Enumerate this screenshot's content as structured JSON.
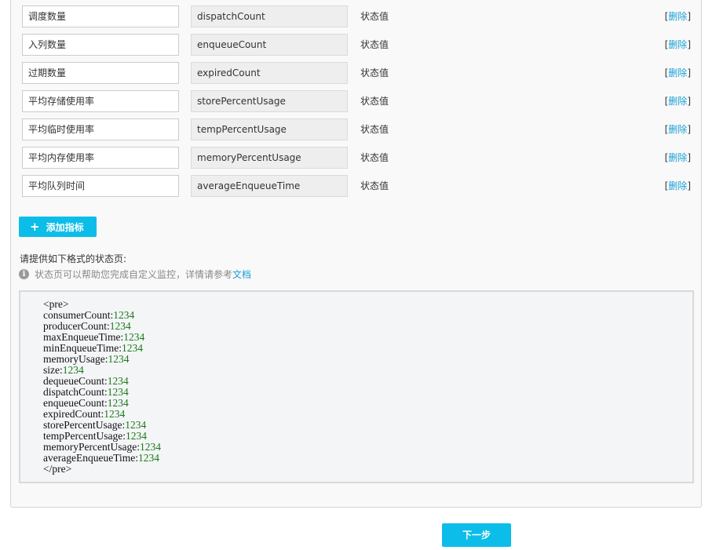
{
  "metrics": [
    {
      "name": "调度数量",
      "key": "dispatchCount",
      "type": "状态值",
      "delete": "删除"
    },
    {
      "name": "入列数量",
      "key": "enqueueCount",
      "type": "状态值",
      "delete": "删除"
    },
    {
      "name": "过期数量",
      "key": "expiredCount",
      "type": "状态值",
      "delete": "删除"
    },
    {
      "name": "平均存储使用率",
      "key": "storePercentUsage",
      "type": "状态值",
      "delete": "删除"
    },
    {
      "name": "平均临时使用率",
      "key": "tempPercentUsage",
      "type": "状态值",
      "delete": "删除"
    },
    {
      "name": "平均内存使用率",
      "key": "memoryPercentUsage",
      "type": "状态值",
      "delete": "删除"
    },
    {
      "name": "平均队列时间",
      "key": "averageEnqueueTime",
      "type": "状态值",
      "delete": "删除"
    }
  ],
  "add_button": {
    "icon": "plus-icon",
    "label": "添加指标"
  },
  "hint": {
    "title": "请提供如下格式的状态页:",
    "info_icon": "info-icon",
    "text": "状态页可以帮助您完成自定义监控，详情请参考",
    "link": "文档"
  },
  "code": {
    "open_tag": "<pre>",
    "close_tag": "</pre>",
    "lines": [
      {
        "key": "consumerCount:",
        "value": "1234"
      },
      {
        "key": "producerCount:",
        "value": "1234"
      },
      {
        "key": "maxEnqueueTime:",
        "value": "1234"
      },
      {
        "key": "minEnqueueTime:",
        "value": "1234"
      },
      {
        "key": "memoryUsage:",
        "value": "1234"
      },
      {
        "key": "size:",
        "value": "1234"
      },
      {
        "key": "dequeueCount:",
        "value": "1234"
      },
      {
        "key": "dispatchCount:",
        "value": "1234"
      },
      {
        "key": "enqueueCount:",
        "value": "1234"
      },
      {
        "key": "expiredCount:",
        "value": "1234"
      },
      {
        "key": "storePercentUsage:",
        "value": "1234"
      },
      {
        "key": "tempPercentUsage:",
        "value": "1234"
      },
      {
        "key": "memoryPercentUsage:",
        "value": "1234"
      },
      {
        "key": "averageEnqueueTime:",
        "value": "1234"
      }
    ]
  },
  "next_button": {
    "label": "下一步"
  },
  "colors": {
    "accent": "#0bbde8",
    "link": "#1aa0d8",
    "code_value": "#1a7a1a"
  }
}
